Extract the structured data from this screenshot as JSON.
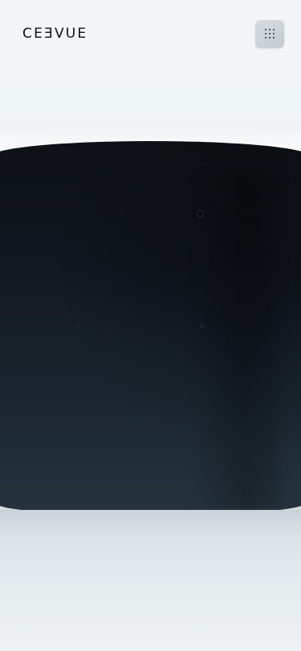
{
  "header": {
    "brand": "CEƎVUE",
    "brand_logo_icon": "ceevue-wordmark",
    "menu_icon": "grid-dots-icon"
  },
  "hero": {
    "description": "",
    "panel_color": "#121820"
  },
  "colors": {
    "background": "#eef3f6",
    "panel_dark": "#0d1115",
    "panel_light": "#26333e",
    "button": "#cfd5d9",
    "text": "#0c1218"
  }
}
